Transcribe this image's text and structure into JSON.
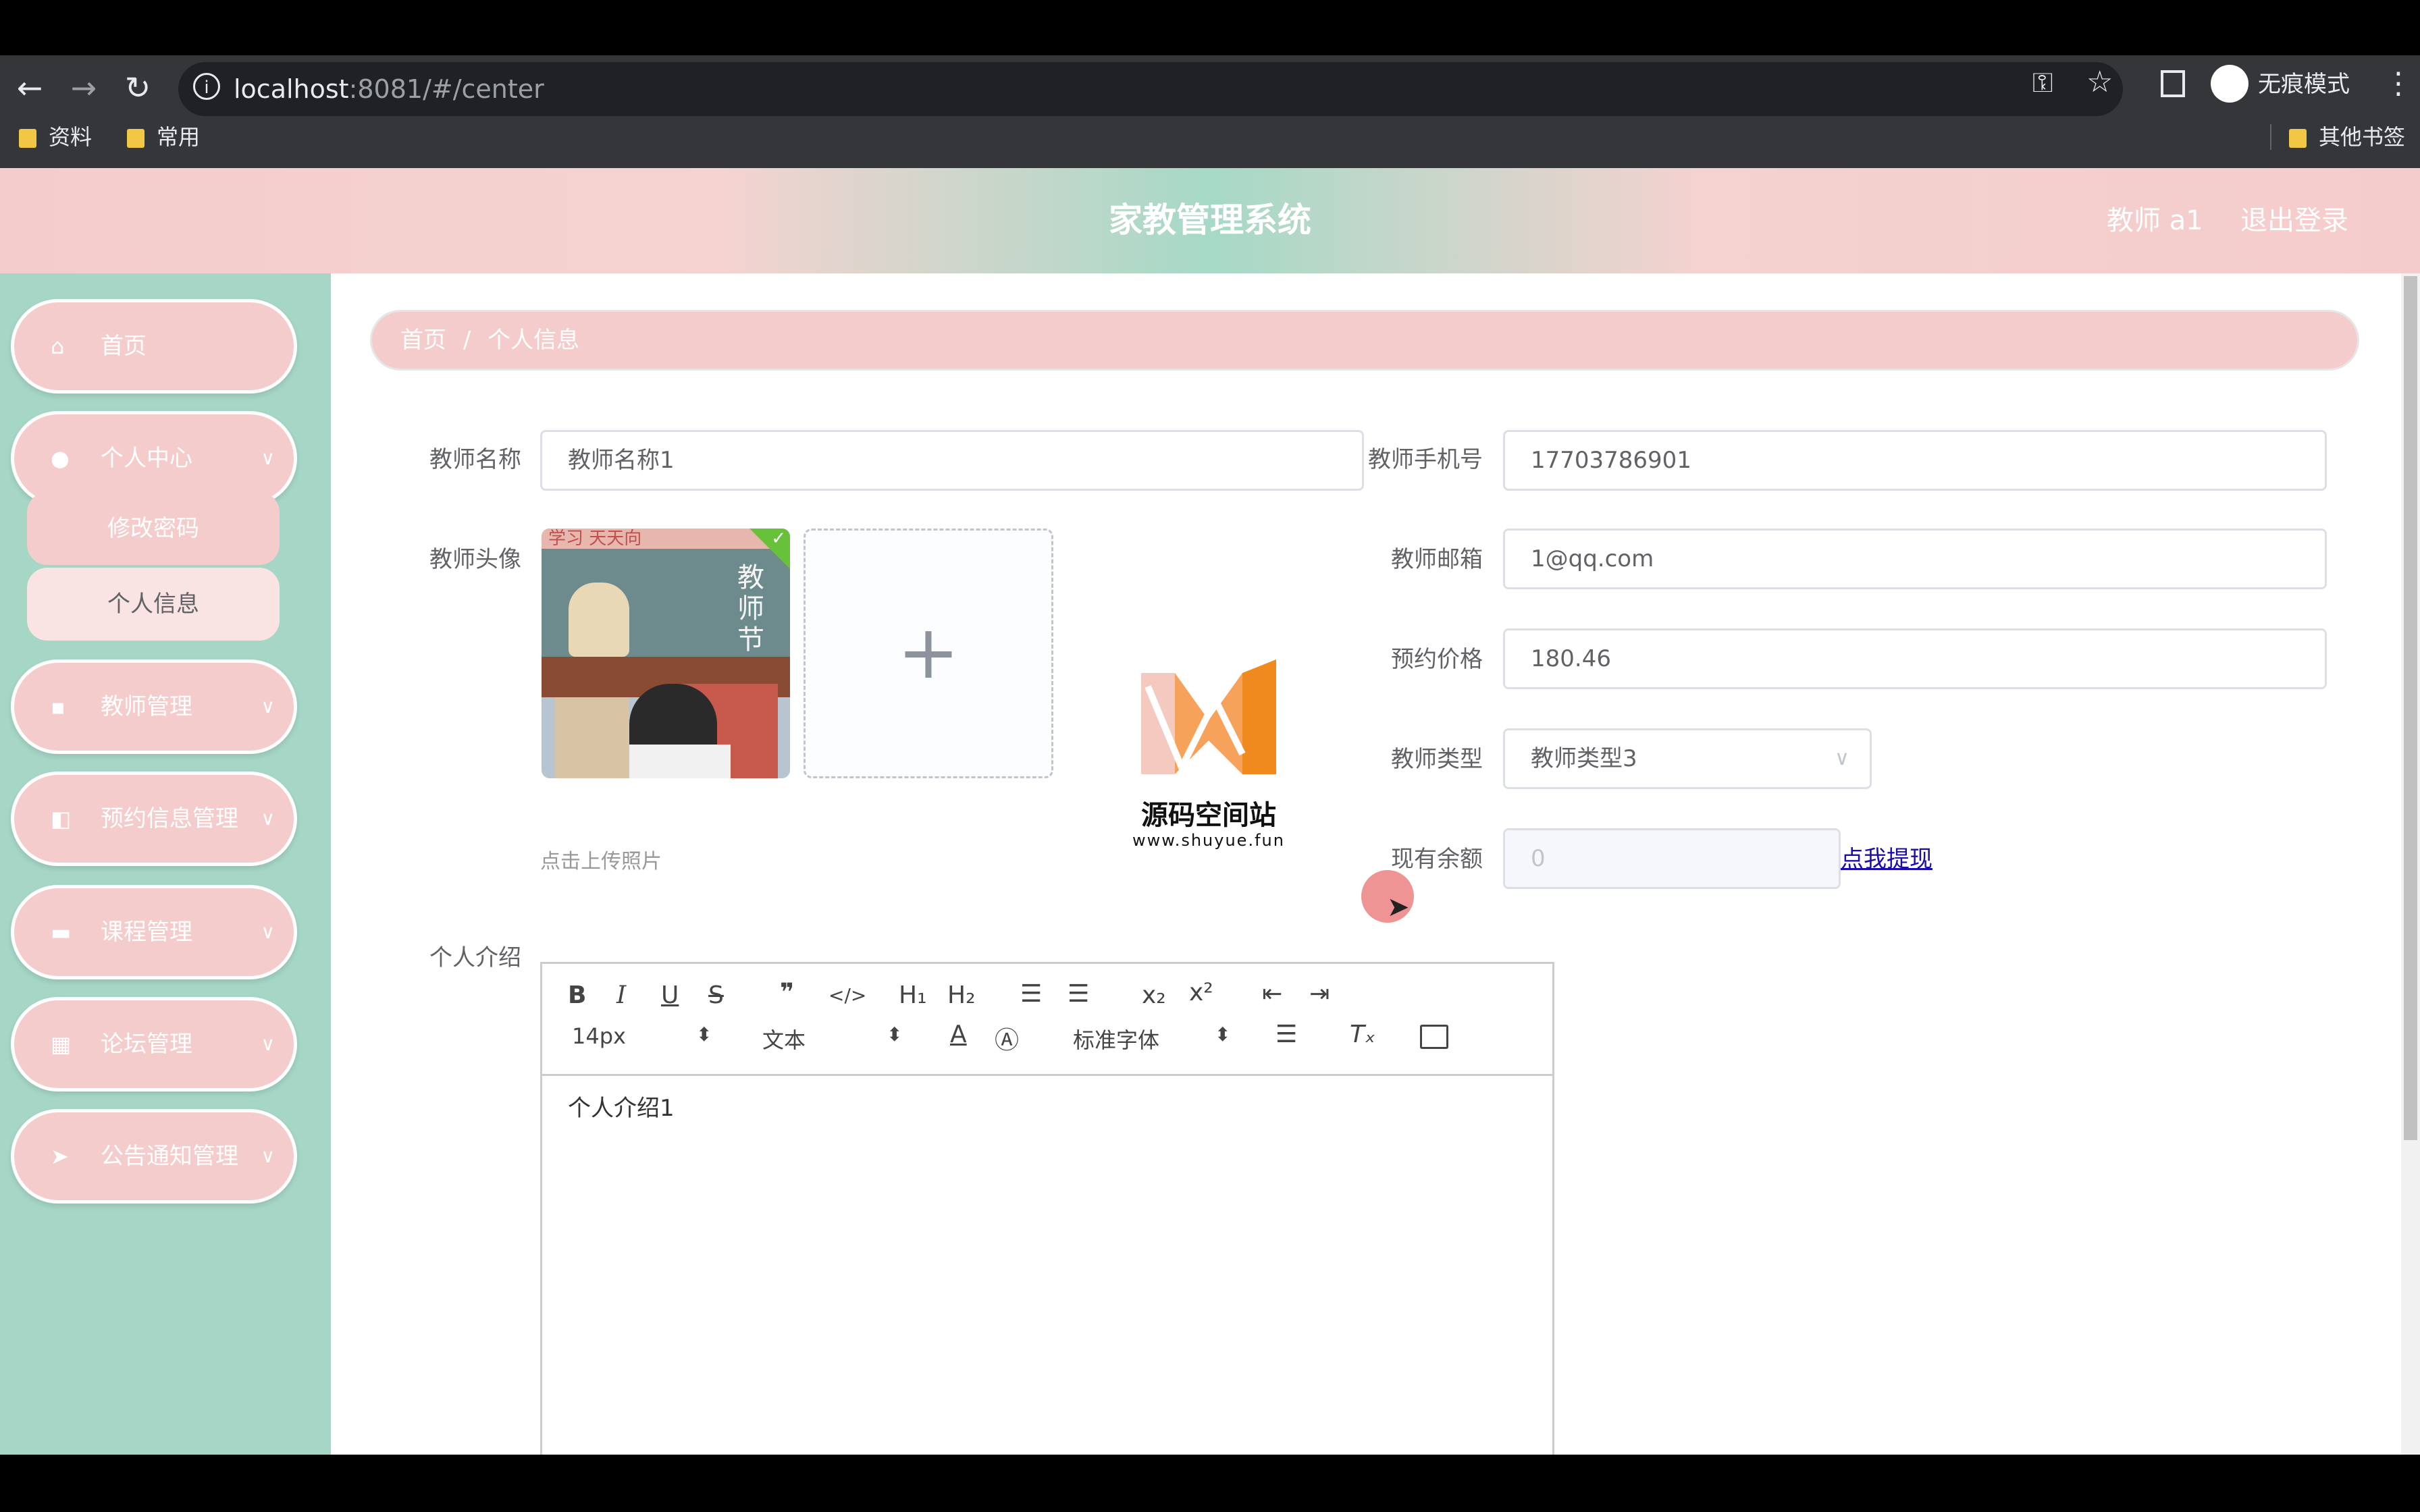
{
  "browser": {
    "url_host": "localhost",
    "url_path": ":8081/#/center",
    "incognito_label": "无痕模式",
    "bookmarks": [
      "资料",
      "常用"
    ],
    "other_bookmarks": "其他书签"
  },
  "header": {
    "title": "家教管理系统",
    "user_label": "教师 a1",
    "logout_label": "退出登录"
  },
  "sidebar": {
    "items": [
      {
        "label": "首页",
        "icon": "home-icon"
      },
      {
        "label": "个人中心",
        "icon": "user-icon"
      },
      {
        "label": "教师管理",
        "icon": "book-icon"
      },
      {
        "label": "预约信息管理",
        "icon": "video-icon"
      },
      {
        "label": "课程管理",
        "icon": "briefcase-icon"
      },
      {
        "label": "论坛管理",
        "icon": "grid-icon"
      },
      {
        "label": "公告通知管理",
        "icon": "send-icon"
      }
    ],
    "submenu": [
      "修改密码",
      "个人信息"
    ]
  },
  "breadcrumb": {
    "home": "首页",
    "separator": "/",
    "current": "个人信息"
  },
  "form": {
    "name_label": "教师名称",
    "name_value": "教师名称1",
    "phone_label": "教师手机号",
    "phone_value": "17703786901",
    "avatar_label": "教师头像",
    "upload_hint": "点击上传照片",
    "email_label": "教师邮箱",
    "email_value": "1@qq.com",
    "price_label": "预约价格",
    "price_value": "180.46",
    "type_label": "教师类型",
    "type_value": "教师类型3",
    "balance_label": "现有余额",
    "balance_value": "0",
    "withdraw_link": "点我提现",
    "intro_label": "个人介绍",
    "intro_value": "个人介绍1"
  },
  "editor_toolbar": {
    "font_size": "14px",
    "block_type": "文本",
    "font_family": "标准字体"
  },
  "avatar_image_text": {
    "line1": "学习  天天向",
    "line2": "教师节"
  },
  "watermark": {
    "title": "源码空间站",
    "url": "www.shuyue.fun"
  },
  "colors": {
    "accent_pink": "#f4cccb",
    "accent_green": "#a5d6c6",
    "link_blue": "#1a0dab"
  }
}
